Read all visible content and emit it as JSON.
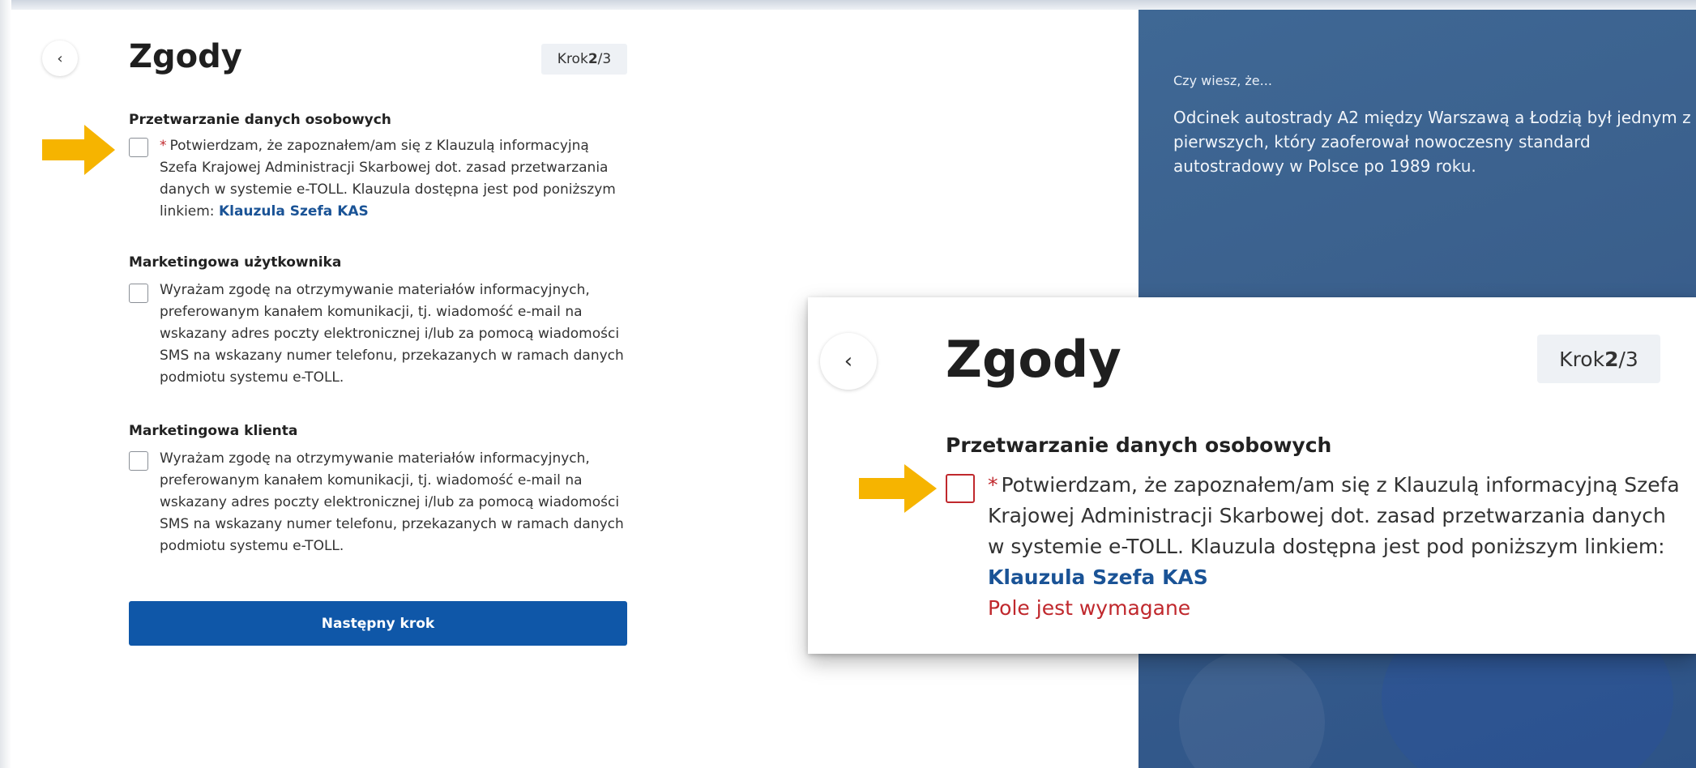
{
  "form": {
    "back_icon": "‹",
    "title": "Zgody",
    "step": {
      "prefix": "Krok ",
      "current": "2",
      "total": "/3"
    },
    "sections": [
      {
        "heading": "Przetwarzanie danych osobowych",
        "required": "*",
        "text": "Potwierdzam, że zapoznałem/am się z Klauzulą informacyjną Szefa Krajowej Administracji Skarbowej dot. zasad przetwarzania danych w systemie e-TOLL. Klauzula dostępna jest pod poniższym linkiem: ",
        "link": "Klauzula Szefa KAS"
      },
      {
        "heading": "Marketingowa użytkownika",
        "text": "Wyrażam zgodę na otrzymywanie materiałów informacyjnych, preferowanym kanałem komunikacji, tj. wiadomość e-mail na wskazany adres poczty elektronicznej i/lub za pomocą wiadomości SMS na wskazany numer telefonu, przekazanych w ramach danych podmiotu systemu e-TOLL."
      },
      {
        "heading": "Marketingowa klienta",
        "text": "Wyrażam zgodę na otrzymywanie materiałów informacyjnych, preferowanym kanałem komunikacji, tj. wiadomość e-mail na wskazany adres poczty elektronicznej i/lub za pomocą wiadomości SMS na wskazany numer telefonu, przekazanych w ramach danych podmiotu systemu e-TOLL."
      }
    ],
    "next_label": "Następny krok"
  },
  "info": {
    "kicker": "Czy wiesz, że...",
    "text": "Odcinek autostrady A2 między Warszawą a Łodzią był jednym z pierwszych, który zaoferował nowoczesny standard autostradowy w Polsce po 1989 roku."
  },
  "zoom": {
    "back_icon": "‹",
    "title": "Zgody",
    "step": {
      "prefix": "Krok ",
      "current": "2",
      "total": "/3"
    },
    "heading": "Przetwarzanie danych osobowych",
    "required": "*",
    "text": "Potwierdzam, że zapoznałem/am się z Klauzulą informacyjną Szefa Krajowej Administracji Skarbowej dot. zasad przetwarzania danych w systemie e-TOLL. Klauzula dostępna jest pod poniższym linkiem: ",
    "link": "Klauzula Szefa KAS",
    "error": "Pole jest wymagane"
  },
  "colors": {
    "accent": "#0f57a8",
    "link": "#1a5396",
    "error": "#c0282d",
    "arrow": "#f6b400",
    "panel": "#3a5f8c"
  },
  "icons": [
    "chevron-left-icon",
    "arrow-right-icon"
  ]
}
